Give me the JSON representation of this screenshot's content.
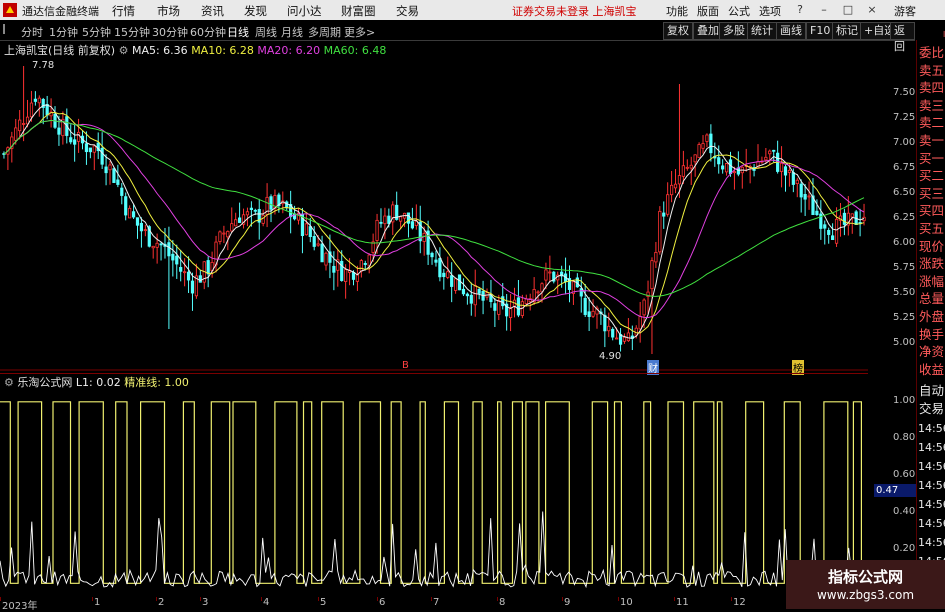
{
  "menubar": {
    "app_title": "通达信金融终端",
    "items": [
      "行情",
      "市场",
      "资讯",
      "发现",
      "问小达",
      "财富圈",
      "交易"
    ],
    "notice": "证券交易未登录  上海凯宝",
    "right_items": [
      "功能",
      "版面",
      "公式",
      "选项"
    ],
    "user": "游客"
  },
  "periods": [
    "分时",
    "1分钟",
    "5分钟",
    "15分钟",
    "30分钟",
    "60分钟",
    "日线",
    "周线",
    "月线",
    "多周期",
    "更多>"
  ],
  "active_period": "日线",
  "toolbar": [
    "复权",
    "叠加",
    "多股",
    "统计",
    "画线",
    "F10",
    "标记",
    "+自选",
    "返回"
  ],
  "main_legend": {
    "name": "上海凯宝(日线 前复权)",
    "ma5": "MA5: 6.36",
    "ma10": "MA10: 6.28",
    "ma20": "MA20: 6.20",
    "ma60": "MA60: 6.48"
  },
  "indicator_legend": {
    "name": "乐淘公式网",
    "l1": "L1: 0.02",
    "precise": "精准线: 1.00"
  },
  "annotations": {
    "high": "7.78",
    "low": "4.90",
    "marker1": "B",
    "marker2": "财",
    "marker3": "榜"
  },
  "right_panel": {
    "labels": [
      "委比",
      "卖五",
      "卖四",
      "卖三",
      "卖二",
      "卖一",
      "买一",
      "买二",
      "买三",
      "买四",
      "买五",
      "现价",
      "涨跌",
      "涨幅",
      "总量",
      "外盘",
      "换手",
      "净资",
      "收益"
    ],
    "auto_trade": [
      "自动",
      "交易"
    ],
    "times": [
      "14:56",
      "14:56",
      "14:56",
      "14:56",
      "14:56",
      "14:56",
      "14:56",
      "14:56",
      "14:56"
    ]
  },
  "indicator_current": "0.47",
  "watermark": {
    "line1": "指标公式网",
    "line2": "www.zbgs3.com"
  },
  "chart_data": [
    {
      "type": "candlestick",
      "title": "上海凯宝(日线 前复权)",
      "y_ticks": [
        7.5,
        7.25,
        7.0,
        6.75,
        6.5,
        6.25,
        6.0,
        5.75,
        5.5,
        5.25,
        5.0
      ],
      "ylim": [
        4.85,
        7.85
      ],
      "x_ticks": [
        "2023年",
        "1",
        "2",
        "3",
        "4",
        "5",
        "6",
        "7",
        "8",
        "9",
        "10",
        "11",
        "12"
      ],
      "close_path": [
        6.9,
        7.2,
        7.5,
        7.3,
        7.1,
        7.0,
        6.95,
        6.7,
        6.3,
        6.1,
        6.0,
        5.8,
        5.6,
        5.75,
        6.1,
        6.3,
        6.25,
        6.4,
        6.35,
        6.2,
        6.0,
        5.8,
        5.7,
        5.85,
        6.2,
        6.35,
        6.2,
        6.0,
        5.75,
        5.6,
        5.5,
        5.4,
        5.3,
        5.4,
        5.6,
        5.7,
        5.6,
        5.4,
        5.3,
        5.1,
        5.0,
        5.4,
        6.3,
        6.6,
        6.8,
        7.0,
        6.8,
        6.7,
        6.8,
        6.9,
        6.7,
        6.5,
        6.3,
        6.15,
        6.2,
        6.3
      ],
      "high": 7.78,
      "low": 4.9,
      "ma5": 6.36,
      "ma10": 6.28,
      "ma20": 6.2,
      "ma60": 6.48,
      "colors": {
        "up": "#ff3232",
        "down": "#54ffff",
        "ma5": "#f0f0f0",
        "ma10": "#f0f040",
        "ma20": "#e040e0",
        "ma60": "#40e040"
      }
    },
    {
      "type": "line",
      "title": "乐淘公式网",
      "y_ticks": [
        1.0,
        0.8,
        0.6,
        0.4,
        0.2
      ],
      "ylim": [
        0,
        1.08
      ],
      "series": [
        {
          "name": "精准线",
          "color": "#f0f070"
        },
        {
          "name": "L1",
          "color": "#ffffff"
        }
      ]
    }
  ]
}
